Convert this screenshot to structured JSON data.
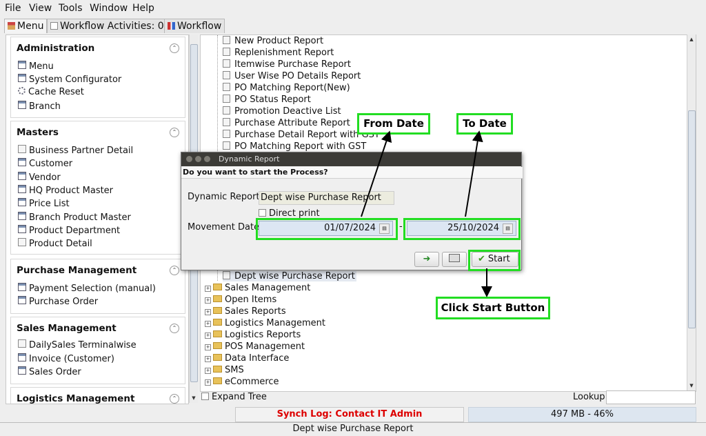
{
  "menubar": {
    "items": [
      "File",
      "View",
      "Tools",
      "Window",
      "Help"
    ]
  },
  "tabs": [
    {
      "label": "Menu"
    },
    {
      "label": "Workflow Activities: 0"
    },
    {
      "label": "Workflow"
    }
  ],
  "sidebar": {
    "sections": [
      {
        "title": "Administration",
        "items": [
          {
            "label": "Menu",
            "icon": "window-icon"
          },
          {
            "label": "System Configurator",
            "icon": "window-icon"
          },
          {
            "label": "Cache Reset",
            "icon": "gear-icon"
          },
          {
            "label": "Branch",
            "icon": "window-icon"
          }
        ]
      },
      {
        "title": "Masters",
        "items": [
          {
            "label": "Business Partner Detail",
            "icon": "report-icon"
          },
          {
            "label": "Customer",
            "icon": "window-icon"
          },
          {
            "label": "Vendor",
            "icon": "window-icon"
          },
          {
            "label": "HQ Product Master",
            "icon": "window-icon"
          },
          {
            "label": "Price List",
            "icon": "window-icon"
          },
          {
            "label": "Branch Product Master",
            "icon": "window-icon"
          },
          {
            "label": "Product Department",
            "icon": "window-icon"
          },
          {
            "label": "Product Detail",
            "icon": "report-icon"
          }
        ]
      },
      {
        "title": "Purchase Management",
        "items": [
          {
            "label": "Payment Selection (manual)",
            "icon": "window-icon"
          },
          {
            "label": "Purchase Order",
            "icon": "window-icon"
          }
        ]
      },
      {
        "title": "Sales Management",
        "items": [
          {
            "label": "DailySales Terminalwise",
            "icon": "report-icon"
          },
          {
            "label": "Invoice (Customer)",
            "icon": "window-icon"
          },
          {
            "label": "Sales Order",
            "icon": "window-icon"
          }
        ]
      },
      {
        "title": "Logistics Management",
        "items": []
      }
    ]
  },
  "tree": {
    "reports_top": [
      "New Product Report",
      "Replenishment Report",
      "Itemwise Purchase Report",
      "User Wise PO Details Report",
      "PO Matching Report(New)",
      "PO Status Report",
      "Promotion Deactive List",
      "Purchase Attribute Report",
      "Purchase Detail Report with GST",
      "PO Matching Report with GST"
    ],
    "selected_report": "Dept wise Purchase Report",
    "folders": [
      "Sales Management",
      "Open Items",
      "Sales Reports",
      "Logistics Management",
      "Logistics Reports",
      "POS Management",
      "Data Interface",
      "SMS",
      "eCommerce"
    ]
  },
  "bottom": {
    "expand_tree_label": "Expand Tree",
    "lookup_label": "Lookup",
    "lookup_value": "",
    "synch_log": "Synch Log: Contact IT Admin",
    "memory": "497 MB - 46%",
    "status_text": "Dept wise Purchase Report"
  },
  "dialog": {
    "title": "Dynamic Report",
    "question": "Do you want to start the Process?",
    "report_label": "Dynamic Report",
    "report_value": "Dept wise Purchase Report",
    "direct_print_label": "Direct print",
    "direct_print_checked": false,
    "movement_date_label": "Movement Date",
    "from_date": "01/07/2024",
    "to_date": "25/10/2024",
    "range_separator": "-",
    "start_label": "Start"
  },
  "annotations": {
    "from_date": "From Date",
    "to_date": "To Date",
    "click_start": "Click Start Button"
  },
  "colors": {
    "highlight": "#22dd22",
    "synch_text": "#dd0000",
    "field_bg": "#dce6f3",
    "titlebar": "#3c3b37"
  }
}
